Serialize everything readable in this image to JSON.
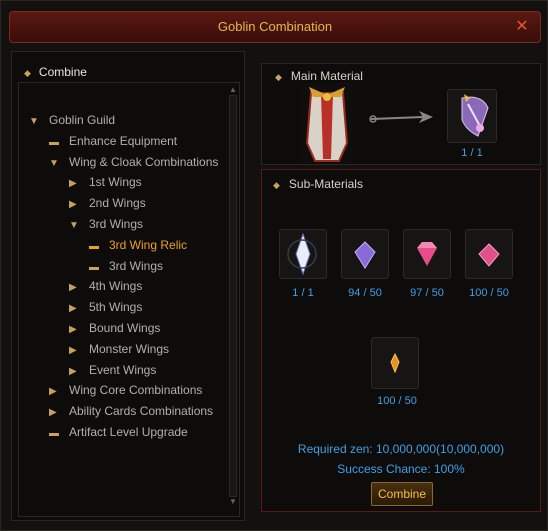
{
  "window": {
    "title": "Goblin Combination",
    "close_icon": "close-x-icon"
  },
  "left": {
    "header": "Combine",
    "tree": [
      {
        "label": "Goblin Guild",
        "mark": "▼"
      },
      {
        "label": "Enhance Equipment",
        "mark": "▬"
      },
      {
        "label": "Wing & Cloak Combinations",
        "mark": "▼"
      },
      {
        "label": "1st Wings",
        "mark": "▶"
      },
      {
        "label": "2nd Wings",
        "mark": "▶"
      },
      {
        "label": "3rd Wings",
        "mark": "▼"
      },
      {
        "label": "3rd Wing Relic",
        "mark": "▬"
      },
      {
        "label": "3rd Wings",
        "mark": "▬"
      },
      {
        "label": "4th Wings",
        "mark": "▶"
      },
      {
        "label": "5th Wings",
        "mark": "▶"
      },
      {
        "label": "Bound Wings",
        "mark": "▶"
      },
      {
        "label": "Monster Wings",
        "mark": "▶"
      },
      {
        "label": "Event Wings",
        "mark": "▶"
      },
      {
        "label": "Wing Core Combinations",
        "mark": "▶"
      },
      {
        "label": "Ability Cards Combinations",
        "mark": "▶"
      },
      {
        "label": "Artifact Level Upgrade",
        "mark": "▬"
      }
    ]
  },
  "main": {
    "label": "Main Material",
    "result_count": "1 / 1"
  },
  "sub": {
    "label": "Sub-Materials",
    "items": [
      {
        "count": "1 / 1"
      },
      {
        "count": "94 / 50"
      },
      {
        "count": "97 / 50"
      },
      {
        "count": "100 / 50"
      },
      {
        "count": "100 / 50"
      }
    ]
  },
  "info": {
    "zen": "Required zen: 10,000,000(10,000,000)",
    "chance": "Success Chance: 100%"
  },
  "combine_label": "Combine",
  "colors": {
    "accent": "#f0a020",
    "count": "#3fa0e8",
    "title": "#e8b84a"
  }
}
